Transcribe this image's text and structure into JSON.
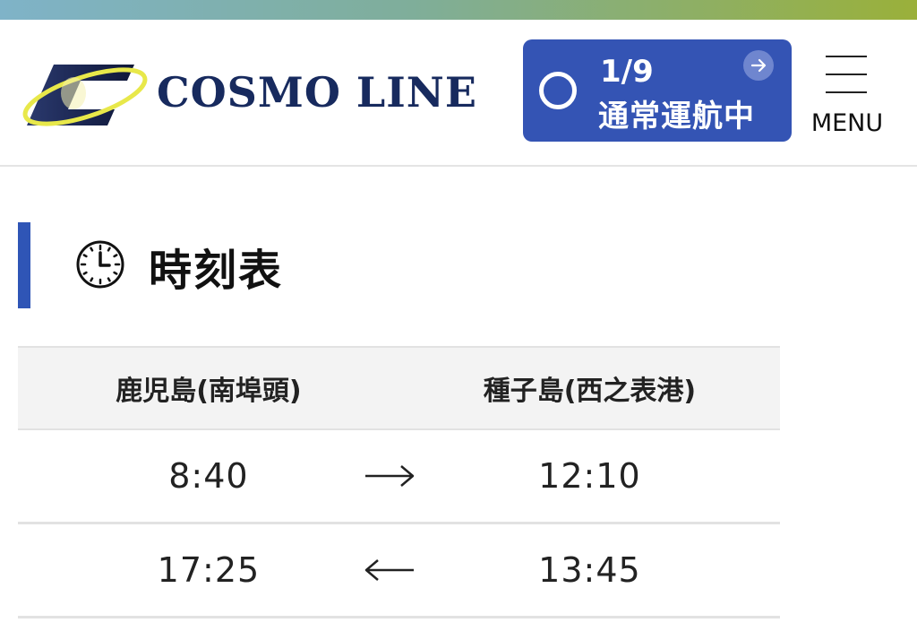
{
  "brand": {
    "name": "COSMO LINE",
    "logo_icon": "cosmo-line-emblem"
  },
  "status": {
    "date": "1/9",
    "text": "通常運航中",
    "indicator_icon": "circle-status-icon",
    "link_icon": "arrow-right-icon",
    "color": "#3454b4"
  },
  "menu": {
    "label": "MENU",
    "icon": "hamburger-icon"
  },
  "section": {
    "title": "時刻表",
    "icon": "clock-icon",
    "accent": "#2f55b6"
  },
  "timetable": {
    "headers": [
      "鹿児島(南埠頭)",
      "種子島(西之表港)"
    ],
    "rows": [
      {
        "left": "8:40",
        "right": "12:10",
        "direction": "right"
      },
      {
        "left": "17:25",
        "right": "13:45",
        "direction": "left"
      }
    ]
  }
}
